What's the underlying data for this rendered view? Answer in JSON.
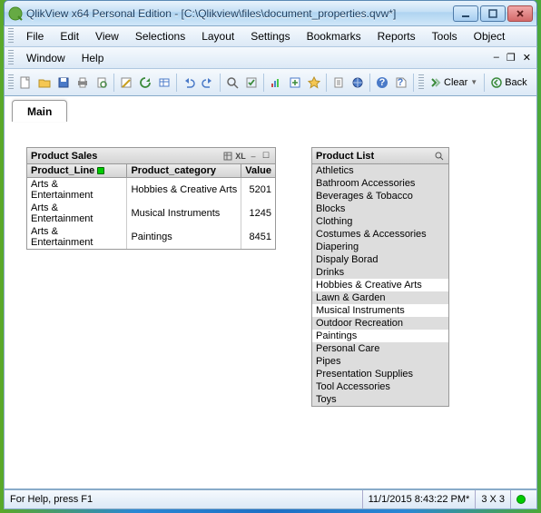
{
  "window": {
    "title": "QlikView x64 Personal Edition - [C:\\Qlikview\\files\\document_properties.qvw*]"
  },
  "menu": {
    "file": "File",
    "edit": "Edit",
    "view": "View",
    "selections": "Selections",
    "layout": "Layout",
    "settings": "Settings",
    "bookmarks": "Bookmarks",
    "reports": "Reports",
    "tools": "Tools",
    "object": "Object",
    "window": "Window",
    "help": "Help"
  },
  "toolbar": {
    "clear": "Clear",
    "back": "Back"
  },
  "tab": {
    "main": "Main"
  },
  "sales": {
    "title": "Product Sales",
    "columns": {
      "line": "Product_Line",
      "category": "Product_category",
      "value": "Value"
    },
    "rows": [
      {
        "line": "Arts & Entertainment",
        "category": "Hobbies & Creative Arts",
        "value": "5201"
      },
      {
        "line": "Arts & Entertainment",
        "category": "Musical Instruments",
        "value": "1245"
      },
      {
        "line": "Arts & Entertainment",
        "category": "Paintings",
        "value": "8451"
      }
    ]
  },
  "productlist": {
    "title": "Product List",
    "items": [
      {
        "label": "Athletics",
        "sel": false
      },
      {
        "label": "Bathroom Accessories",
        "sel": false
      },
      {
        "label": "Beverages & Tobacco",
        "sel": false
      },
      {
        "label": "Blocks",
        "sel": false
      },
      {
        "label": "Clothing",
        "sel": false
      },
      {
        "label": "Costumes & Accessories",
        "sel": false
      },
      {
        "label": "Diapering",
        "sel": false
      },
      {
        "label": "Dispaly Borad",
        "sel": false
      },
      {
        "label": "Drinks",
        "sel": false
      },
      {
        "label": "Hobbies & Creative Arts",
        "sel": true
      },
      {
        "label": "Lawn & Garden",
        "sel": false
      },
      {
        "label": "Musical Instruments",
        "sel": true
      },
      {
        "label": "Outdoor Recreation",
        "sel": false
      },
      {
        "label": "Paintings",
        "sel": true
      },
      {
        "label": "Personal Care",
        "sel": false
      },
      {
        "label": "Pipes",
        "sel": false
      },
      {
        "label": "Presentation Supplies",
        "sel": false
      },
      {
        "label": "Tool Accessories",
        "sel": false
      },
      {
        "label": "Toys",
        "sel": false
      }
    ]
  },
  "status": {
    "help": "For Help, press F1",
    "time": "11/1/2015 8:43:22 PM*",
    "size": "3 X 3"
  }
}
